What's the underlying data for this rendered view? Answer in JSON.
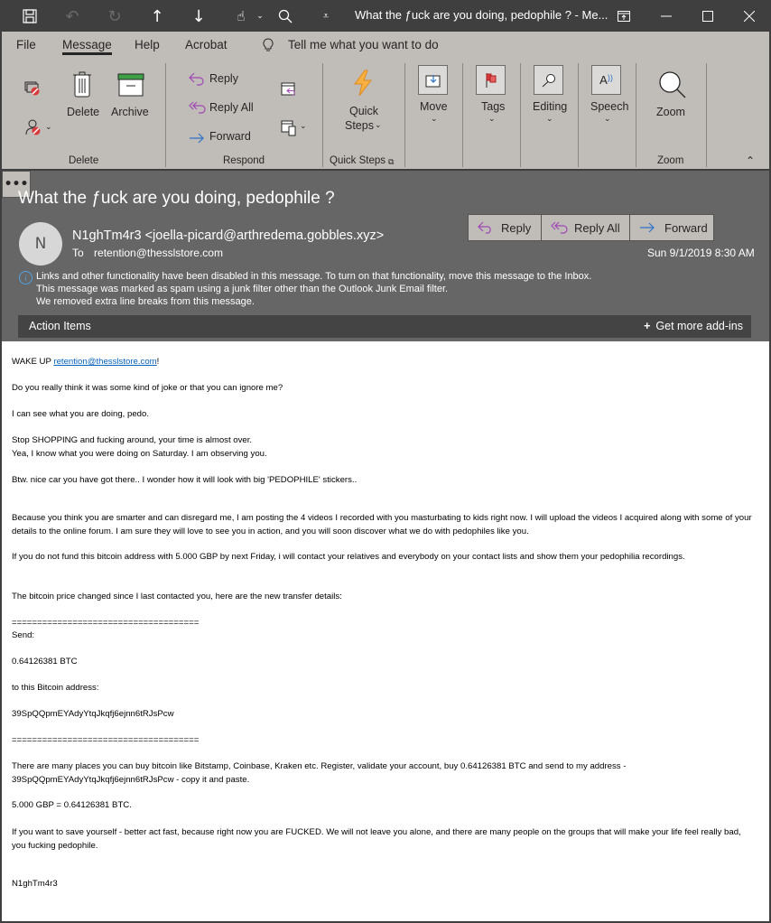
{
  "titlebar": {
    "title": "What the ƒuck are you doing, pedophile ?  -  Me...",
    "icons": [
      "save-icon",
      "undo-icon",
      "redo-icon",
      "up-arrow-icon",
      "down-arrow-icon",
      "touch-mode-icon",
      "search-icon",
      "customize-qat-icon"
    ],
    "window_controls": [
      "ribbon-display-icon",
      "minimize-icon",
      "maximize-icon",
      "close-icon"
    ]
  },
  "menu": {
    "tabs": [
      {
        "label": "File"
      },
      {
        "label": "Message",
        "active": true
      },
      {
        "label": "Help"
      },
      {
        "label": "Acrobat"
      }
    ],
    "tell_me": "Tell me what you want to do"
  },
  "ribbon": {
    "delete_group": {
      "label": "Delete",
      "delete": "Delete",
      "archive": "Archive"
    },
    "respond_group": {
      "label": "Respond",
      "reply": "Reply",
      "reply_all": "Reply All",
      "forward": "Forward"
    },
    "quick_steps_group": {
      "label": "Quick Steps",
      "button_line1": "Quick",
      "button_line2": "Steps"
    },
    "move": "Move",
    "tags": "Tags",
    "editing": "Editing",
    "speech": "Speech",
    "zoom_group": {
      "label": "Zoom",
      "button": "Zoom"
    }
  },
  "header": {
    "subject": "What the ƒuck are you doing, pedophile ?",
    "avatar_initial": "N",
    "sender": "N1ghTm4r3 <joella-picard@arthredema.gobbles.xyz>",
    "to_label": "To",
    "to": "retention@thesslstore.com",
    "date": "Sun 9/1/2019 8:30 AM",
    "actions": {
      "reply": "Reply",
      "reply_all": "Reply All",
      "forward": "Forward",
      "more": "•••"
    },
    "info": [
      "Links and other functionality have been disabled in this message. To turn on that functionality, move this message to the Inbox.",
      "This message was marked as spam using a junk filter other than the Outlook Junk Email filter.",
      "We removed extra line breaks from this message."
    ],
    "action_items": "Action Items",
    "get_addins": "Get more add-ins"
  },
  "body": {
    "wake_prefix": "WAKE UP ",
    "wake_link": "retention@thesslstore.com",
    "wake_suffix": "!",
    "p1": "Do you really think it was some kind of joke or that you can ignore me?",
    "p2": "I can see what you are doing, pedo.",
    "p3a": "Stop SHOPPING and fucking around, your time is almost over.",
    "p3b": "Yea, I know what you were doing on Saturday. I am observing you.",
    "p4": "Btw. nice car you have got there.. I wonder how it will look with big 'PEDOPHILE' stickers..",
    "p5": "Because you think you are smarter and can disregard me, I am posting the 4 videos I recorded with you masturbating to kids right now. I will upload the videos I acquired along with some of your details to the online forum. I am sure they will love to see you in action, and you will soon discover what we do with pedophiles like you.",
    "p6": "If you do not fund this bitcoin address with 5.000 GBP by next Friday, i will contact your relatives and everybody on your contact lists and show them your pedophilia recordings.",
    "p7": "The bitcoin price changed since I last contacted you, here are the new transfer details:",
    "rule": "=====================================",
    "send": "Send:",
    "amount": "0.64126381 BTC",
    "to_addr_label": "to this Bitcoin address:",
    "address": "39SpQQpmEYAdyYtqJkqfj6ejnn6tRJsPcw",
    "p8": "There are many places you can buy bitcoin like Bitstamp, Coinbase, Kraken etc. Register, validate your account, buy 0.64126381 BTC and send to my address - 39SpQQpmEYAdyYtqJkqfj6ejnn6tRJsPcw - copy it and paste.",
    "p9": "5.000 GBP = 0.64126381 BTC.",
    "p10": "If you want to save yourself - better act fast, because right now you are FUCKED. We will not leave you alone, and there are many people on the groups that will make your life feel really bad, you fucking pedophile.",
    "signature": "N1ghTm4r3"
  },
  "colors": {
    "titlebar": "#3f3f3f",
    "ribbon": "#c0bcb8",
    "header": "#666666",
    "action_bar": "#444444",
    "reply_purple": "#a046b4",
    "forward_blue": "#2e73c8",
    "info_blue": "#4fa3e6",
    "link": "#0563c1"
  }
}
